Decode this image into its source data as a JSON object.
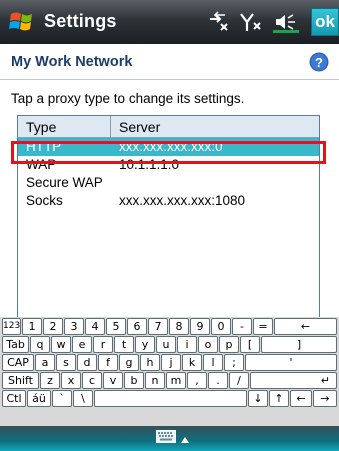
{
  "titlebar": {
    "title": "Settings",
    "ok_label": "ok"
  },
  "header": {
    "title": "My Work Network"
  },
  "instruction": "Tap a proxy type to change its settings.",
  "table": {
    "columns": [
      "Type",
      "Server"
    ],
    "rows": [
      {
        "type": "HTTP",
        "server": "xxx.xxx.xxx.xxx:0",
        "selected": true
      },
      {
        "type": "WAP",
        "server": "10.1.1.1:0",
        "selected": false
      },
      {
        "type": "Secure WAP",
        "server": "",
        "selected": false
      },
      {
        "type": "Socks",
        "server": "xxx.xxx.xxx.xxx:1080",
        "selected": false
      }
    ]
  },
  "keyboard": {
    "rows": [
      [
        "123",
        "1",
        "2",
        "3",
        "4",
        "5",
        "6",
        "7",
        "8",
        "9",
        "0",
        "-",
        "=",
        "←"
      ],
      [
        "Tab",
        "q",
        "w",
        "e",
        "r",
        "t",
        "y",
        "u",
        "i",
        "o",
        "p",
        "[",
        "]"
      ],
      [
        "CAP",
        "a",
        "s",
        "d",
        "f",
        "g",
        "h",
        "j",
        "k",
        "l",
        ";",
        "'"
      ],
      [
        "Shift",
        "z",
        "x",
        "c",
        "v",
        "b",
        "n",
        "m",
        ",",
        ".",
        "/",
        "↵"
      ],
      [
        "Ctl",
        "áü",
        "`",
        "\\",
        "",
        "↓",
        "↑",
        "←",
        "→"
      ]
    ]
  },
  "colors": {
    "selection": "#3bb6cb",
    "highlight_box": "#e3121d",
    "title_text": "#1c3c68"
  }
}
